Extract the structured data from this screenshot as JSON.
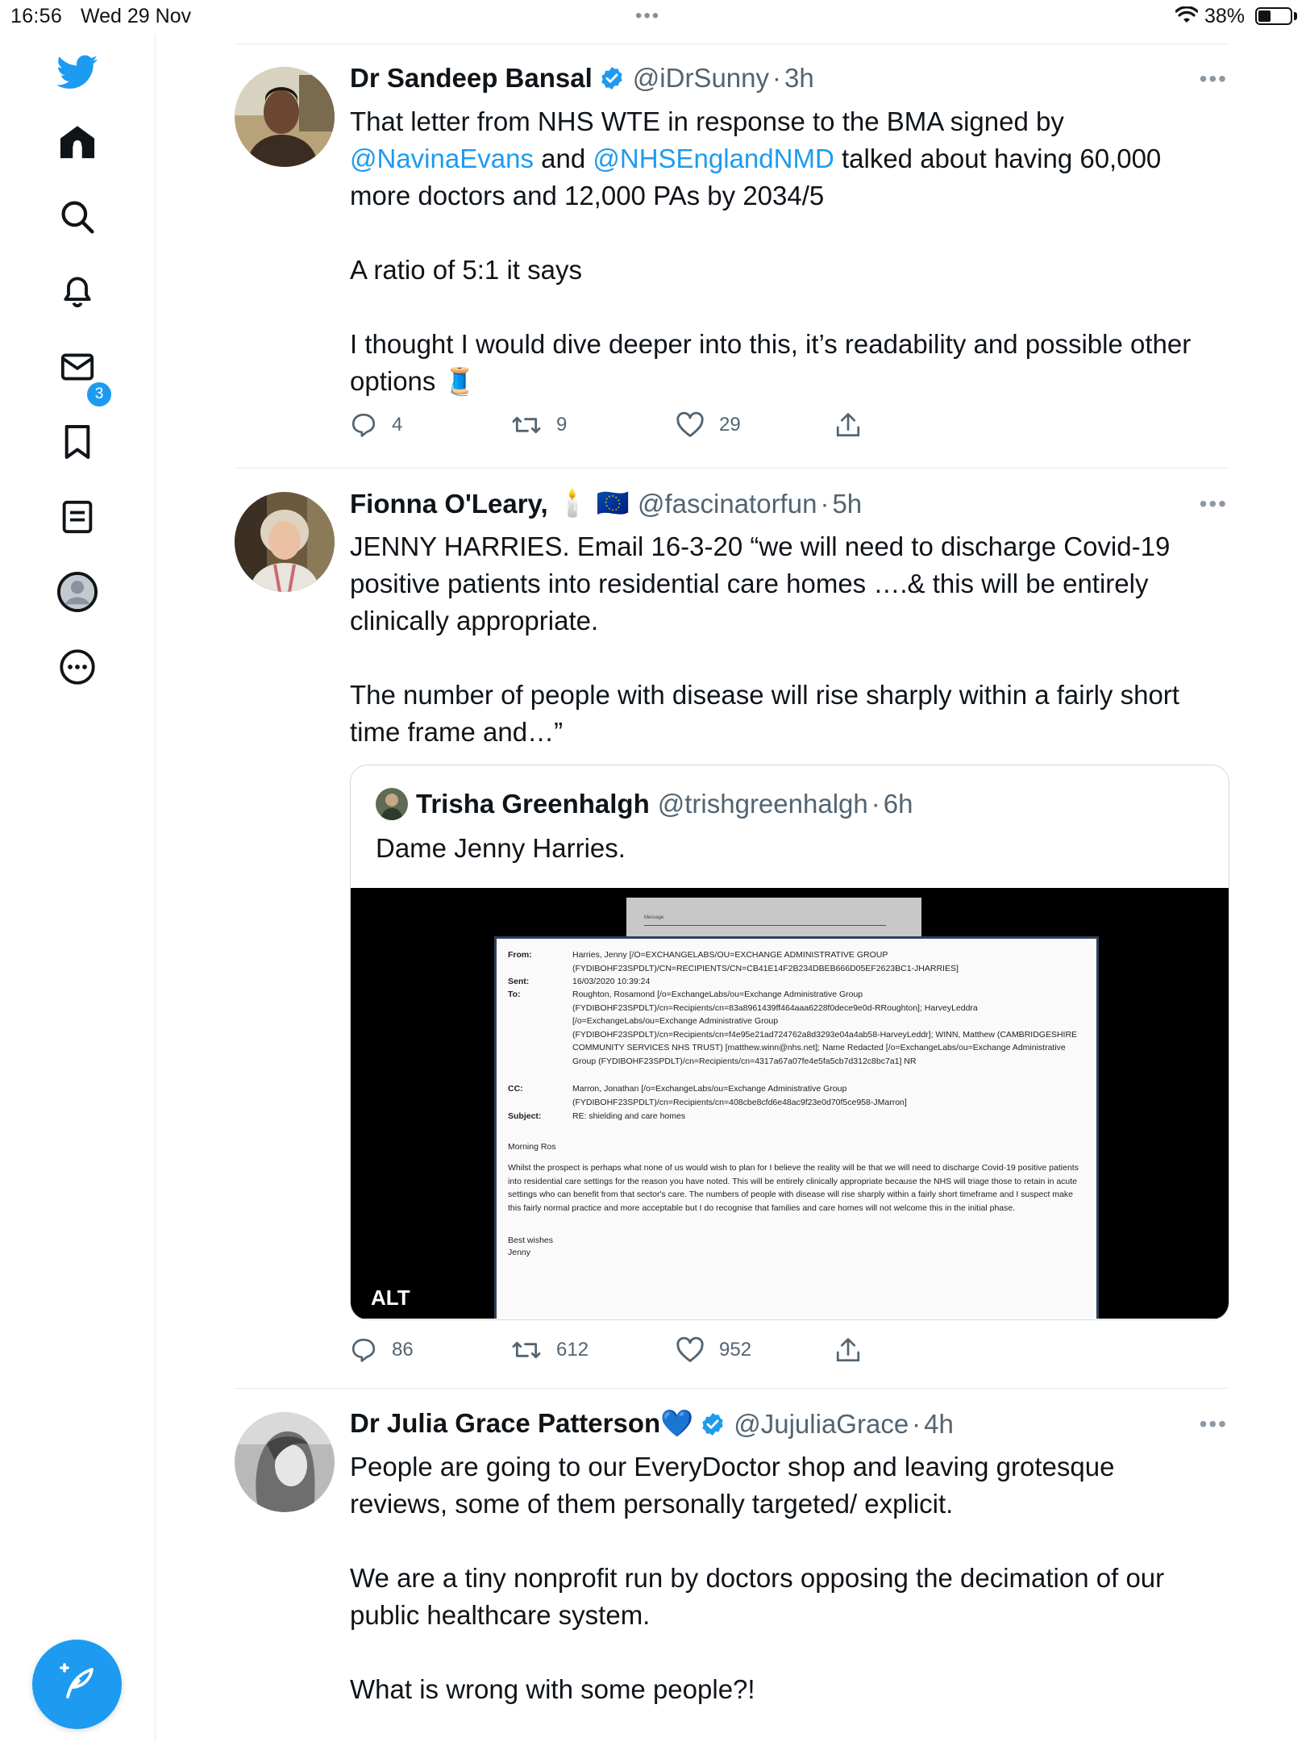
{
  "status_bar": {
    "time": "16:56",
    "date": "Wed 29 Nov",
    "dots": "•••",
    "battery_pct": "38%"
  },
  "sidebar": {
    "items": [
      {
        "icon": "twitter-bird-icon"
      },
      {
        "icon": "home-icon"
      },
      {
        "icon": "search-icon"
      },
      {
        "icon": "bell-icon",
        "badge": "3"
      },
      {
        "icon": "mail-icon"
      },
      {
        "icon": "bookmark-icon"
      },
      {
        "icon": "list-icon"
      },
      {
        "icon": "profile-icon"
      },
      {
        "icon": "more-icon"
      }
    ],
    "compose_icon": "compose-feather-icon"
  },
  "colors": {
    "accent": "#1d9bf0",
    "text": "#0f1419",
    "muted": "#536471"
  },
  "tweets": [
    {
      "name": "Dr Sandeep Bansal",
      "handle": "@iDrSunny",
      "sep": "·",
      "time": "3h",
      "more": "•••",
      "text_p1_a": "That letter from NHS WTE in response to the BMA signed by",
      "mention1": "@NavinaEvans",
      "text_p1_b": " and ",
      "mention2": "@NHSEnglandNMD",
      "text_p1_c": " talked about having 60,000 more doctors and 12,000 PAs by 2034/5",
      "text_p2": "A ratio of 5:1 it says",
      "text_p3": "I thought I would dive deeper into this, it’s readability and possible other options 🧵",
      "replies": "4",
      "retweets": "9",
      "likes": "29"
    },
    {
      "name": "Fionna O'Leary,",
      "flags": "🕯️ 🇪🇺",
      "handle": "@fascinatorfun",
      "sep": "·",
      "time": "5h",
      "more": "•••",
      "text_p1": "JENNY HARRIES.  Email 16-3-20  “we will need to discharge Covid-19 positive patients into residential care homes ….& this will be entirely clinically appropriate.",
      "text_p2": "The number of people with disease will rise sharply within a fairly short time frame and…”",
      "quote": {
        "name": "Trisha Greenhalgh",
        "handle": "@trishgreenhalgh",
        "sep": "·",
        "time": "6h",
        "text": "Dame Jenny Harries.",
        "alt": "ALT",
        "email": {
          "back_label": "Message",
          "from_label": "From:",
          "from": "Harries, Jenny [/O=EXCHANGELABS/OU=EXCHANGE ADMINISTRATIVE GROUP (FYDIBOHF23SPDLT)/CN=RECIPIENTS/CN=CB41E14F2B234DBEB666D05EF2623BC1-JHARRIES]",
          "sent_label": "Sent:",
          "sent": "16/03/2020 10:39:24",
          "to_label": "To:",
          "to": "Roughton, Rosamond [/o=ExchangeLabs/ou=Exchange Administrative Group (FYDIBOHF23SPDLT)/cn=Recipients/cn=83a8961439ff464aaa6228f0dece9e0d-RRoughton]; HarveyLeddra [/o=ExchangeLabs/ou=Exchange Administrative Group (FYDIBOHF23SPDLT)/cn=Recipients/cn=f4e95e21ad724762a8d3293e04a4ab58-HarveyLeddr]; WINN, Matthew (CAMBRIDGESHIRE COMMUNITY SERVICES NHS TRUST) [matthew.winn@nhs.net]; Name Redacted [/o=ExchangeLabs/ou=Exchange Administrative Group (FYDIBOHF23SPDLT)/cn=Recipients/cn=4317a67a07fe4e5fa5cb7d312c8bc7a1] NR",
          "cc_label": "CC:",
          "cc": "Marron, Jonathan [/o=ExchangeLabs/ou=Exchange Administrative Group (FYDIBOHF23SPDLT)/cn=Recipients/cn=408cbe8cfd6e48ac9f23e0d70f5ce958-JMarron]",
          "subject_label": "Subject:",
          "subject": "RE: shielding and care homes",
          "greeting": "Morning Ros",
          "body": "Whilst the prospect is perhaps what none of us would wish to plan for I believe the reality will be that we will need to discharge Covid-19 positive patients into residential care settings for the reason you have noted. This will be entirely clinically appropriate because the NHS will triage those to retain in acute settings who can benefit from that sector's care. The numbers of people with disease will rise sharply within a fairly short timeframe and I suspect make this fairly normal practice and more acceptable but I do recognise that families and care homes will not welcome this in the initial phase.",
          "signoff": "Best wishes",
          "signature": "Jenny"
        }
      },
      "replies": "86",
      "retweets": "612",
      "likes": "952"
    },
    {
      "name": "Dr Julia Grace Patterson💙",
      "handle": "@JujuliaGrace",
      "sep": "·",
      "time": "4h",
      "more": "•••",
      "text_p1": "People are going to our EveryDoctor shop and leaving grotesque reviews, some of them personally targeted/ explicit.",
      "text_p2": "We are a tiny nonprofit run by doctors opposing the decimation of our public healthcare system.",
      "text_p3": "What is wrong with some people?!"
    }
  ]
}
